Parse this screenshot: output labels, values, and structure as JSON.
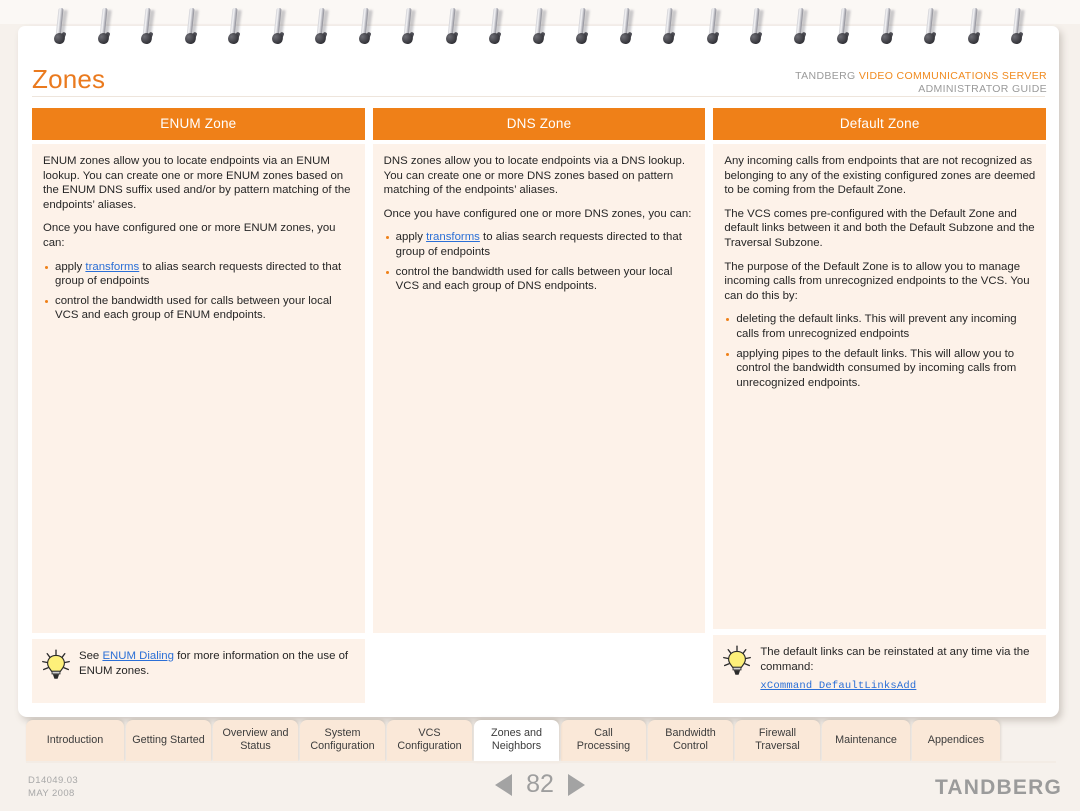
{
  "document": {
    "page_title": "Zones",
    "brand_prefix": "TANDBERG",
    "brand_product": "VIDEO COMMUNICATIONS SERVER",
    "brand_subtitle": "ADMINISTRATOR GUIDE",
    "doc_number": "D14049.03",
    "doc_date": "MAY 2008",
    "page_number": "82",
    "company": "TANDBERG"
  },
  "columns": [
    {
      "id": "enum-zone",
      "heading": "ENUM Zone",
      "paragraphs": [
        "ENUM zones allow you to locate endpoints via an ENUM lookup. You can create one or more ENUM zones based on the ENUM DNS suffix used and/or by pattern matching of the endpoints’ aliases.",
        "Once you have configured one or more ENUM zones, you can:"
      ],
      "bullets_pre_link": [
        "apply ",
        ""
      ],
      "bullets": [
        {
          "before": "apply ",
          "link": "transforms",
          "after": " to alias search requests directed to that group of endpoints"
        },
        {
          "before": "control the bandwidth used for calls between your local VCS and each group of ENUM endpoints.",
          "link": "",
          "after": ""
        }
      ],
      "tip": {
        "before": "See ",
        "link": "ENUM Dialing",
        "after": " for more information on the use of ENUM zones.",
        "command": ""
      }
    },
    {
      "id": "dns-zone",
      "heading": "DNS Zone",
      "paragraphs": [
        "DNS zones allow you to locate endpoints via a  DNS lookup.  You can create one or more DNS zones based on pattern matching of the endpoints’ aliases.",
        "Once you have configured one or more DNS zones, you can:"
      ],
      "bullets": [
        {
          "before": "apply ",
          "link": "transforms",
          "after": " to alias search requests directed to that group of endpoints"
        },
        {
          "before": "control the bandwidth used for calls between your local VCS and each group of DNS endpoints.",
          "link": "",
          "after": ""
        }
      ],
      "tip": null
    },
    {
      "id": "default-zone",
      "heading": "Default Zone",
      "paragraphs": [
        "Any incoming calls from endpoints that are not recognized as belonging to any of the existing configured zones are deemed to be coming from the Default Zone.",
        "The VCS comes pre-configured with the Default Zone and default links between it and both the Default Subzone and the Traversal Subzone.",
        "The purpose of the Default Zone is to allow you to manage incoming calls from unrecognized endpoints to the VCS.  You can do this by:"
      ],
      "bullets": [
        {
          "before": "deleting the default links.  This will prevent any incoming calls from unrecognized endpoints",
          "link": "",
          "after": ""
        },
        {
          "before": "applying pipes to the default links.  This will allow you to control the bandwidth consumed by incoming calls from unrecognized endpoints.",
          "link": "",
          "after": ""
        }
      ],
      "tip": {
        "before": "The default links can be reinstated at any time via the command:",
        "link": "",
        "after": "",
        "command": "xCommand DefaultLinksAdd"
      }
    }
  ],
  "tabs": [
    {
      "label": "Introduction",
      "line1": "Introduction",
      "line2": "",
      "active": false,
      "width": 98
    },
    {
      "label": "Getting Started",
      "line1": "Getting Started",
      "line2": "",
      "active": false,
      "width": 85
    },
    {
      "label": "Overview and Status",
      "line1": "Overview and",
      "line2": "Status",
      "active": false,
      "width": 85
    },
    {
      "label": "System Configuration",
      "line1": "System",
      "line2": "Configuration",
      "active": false,
      "width": 85
    },
    {
      "label": "VCS Configuration",
      "line1": "VCS",
      "line2": "Configuration",
      "active": false,
      "width": 85
    },
    {
      "label": "Zones and Neighbors",
      "line1": "Zones and",
      "line2": "Neighbors",
      "active": true,
      "width": 85
    },
    {
      "label": "Call Processing",
      "line1": "Call",
      "line2": "Processing",
      "active": false,
      "width": 85
    },
    {
      "label": "Bandwidth Control",
      "line1": "Bandwidth",
      "line2": "Control",
      "active": false,
      "width": 85
    },
    {
      "label": "Firewall Traversal",
      "line1": "Firewall",
      "line2": "Traversal",
      "active": false,
      "width": 85
    },
    {
      "label": "Maintenance",
      "line1": "Maintenance",
      "line2": "",
      "active": false,
      "width": 88
    },
    {
      "label": "Appendices",
      "line1": "Appendices",
      "line2": "",
      "active": false,
      "width": 88
    }
  ],
  "icons": {
    "bulb": "lightbulb-icon",
    "prev": "previous-page-arrow",
    "next": "next-page-arrow"
  },
  "colors": {
    "accent_orange": "#ef8018",
    "title_orange": "#ea7a1e",
    "box_cream": "#fdf2e9",
    "tab_cream": "#fae8d8",
    "link_blue": "#2b6fd6",
    "footer_grey": "#9e9e9e"
  }
}
